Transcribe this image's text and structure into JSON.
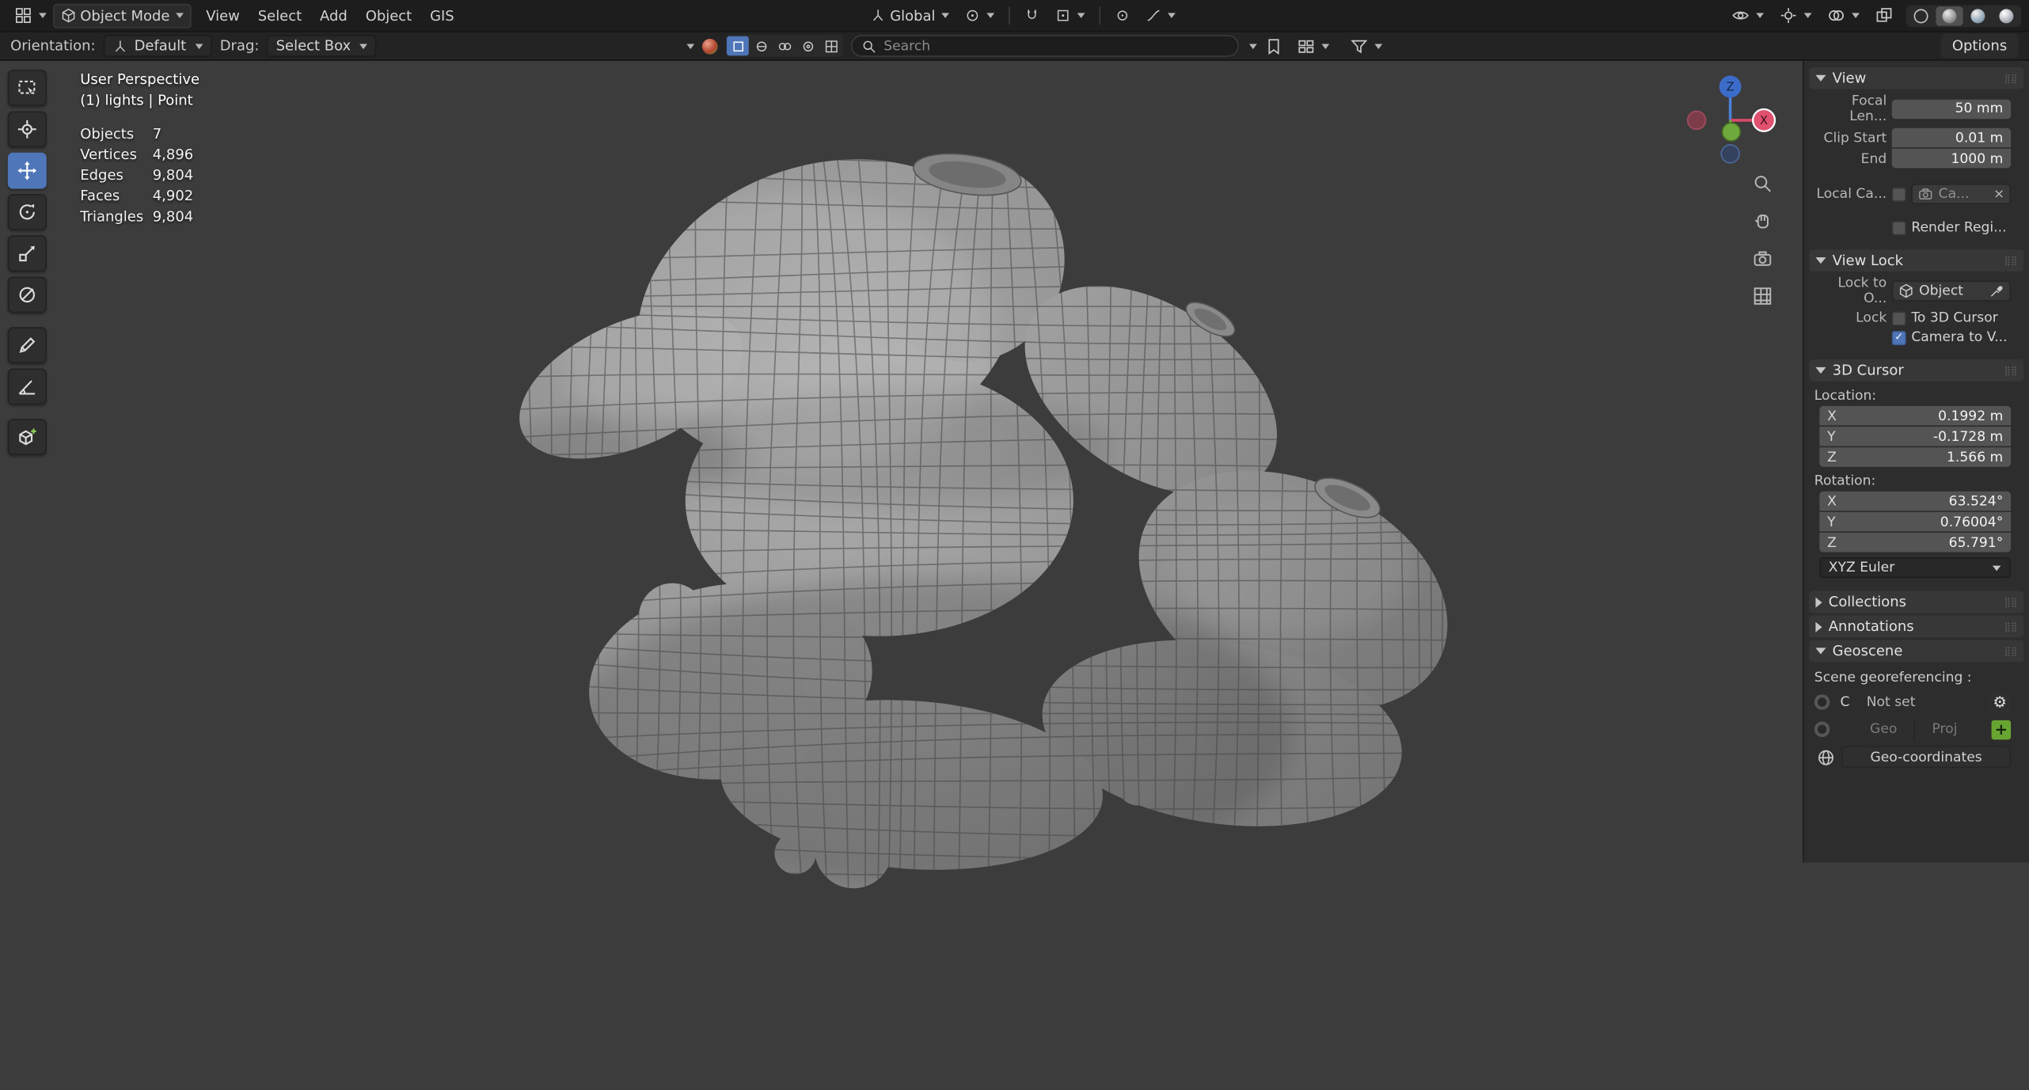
{
  "icons": {
    "check": "✓",
    "gear": "⚙",
    "close": "×",
    "grip": "⣿⣿"
  },
  "topbar": {
    "mode_label": "Object Mode",
    "menus": [
      {
        "label": "View"
      },
      {
        "label": "Select"
      },
      {
        "label": "Add"
      },
      {
        "label": "Object"
      },
      {
        "label": "GIS"
      }
    ],
    "orientation_value": "Global"
  },
  "toolbar": {
    "orientation_label": "Orientation:",
    "orientation_value": "Default",
    "drag_label": "Drag:",
    "drag_value": "Select Box",
    "search_placeholder": "Search",
    "options_label": "Options"
  },
  "viewport": {
    "view_name": "User Perspective",
    "view_sub": "(1) lights | Point",
    "stats": [
      {
        "label": "Objects",
        "value": "7"
      },
      {
        "label": "Vertices",
        "value": "4,896"
      },
      {
        "label": "Edges",
        "value": "9,804"
      },
      {
        "label": "Faces",
        "value": "4,902"
      },
      {
        "label": "Triangles",
        "value": "9,804"
      }
    ],
    "axis_x": "X",
    "axis_z": "Z"
  },
  "sidebar": {
    "view": {
      "title": "View",
      "focal_label": "Focal Len...",
      "focal_value": "50 mm",
      "clip_start_label": "Clip Start",
      "clip_start_value": "0.01 m",
      "clip_end_label": "End",
      "clip_end_value": "1000 m",
      "local_camera_label": "Local Ca...",
      "local_camera_value": "Ca...",
      "render_region_label": "Render Regi..."
    },
    "view_lock": {
      "title": "View Lock",
      "lock_to_label": "Lock to O...",
      "lock_to_value": "Object",
      "lock_label": "Lock",
      "to_3d_cursor_label": "To 3D Cursor",
      "camera_to_view_label": "Camera to V..."
    },
    "cursor3d": {
      "title": "3D Cursor",
      "location_label": "Location:",
      "location": [
        {
          "axis": "X",
          "value": "0.1992 m"
        },
        {
          "axis": "Y",
          "value": "-0.1728 m"
        },
        {
          "axis": "Z",
          "value": "1.566 m"
        }
      ],
      "rotation_label": "Rotation:",
      "rotation": [
        {
          "axis": "X",
          "value": "63.524°"
        },
        {
          "axis": "Y",
          "value": "0.76004°"
        },
        {
          "axis": "Z",
          "value": "65.791°"
        }
      ],
      "euler_mode": "XYZ Euler"
    },
    "collections_title": "Collections",
    "annotations_title": "Annotations",
    "geoscene": {
      "title": "Geoscene",
      "georef_label": "Scene georeferencing :",
      "crs_letter": "C",
      "crs_value": "Not set",
      "geo_label": "Geo",
      "proj_label": "Proj",
      "plus_label": "+",
      "geo_coordinates_label": "Geo-coordinates"
    }
  }
}
